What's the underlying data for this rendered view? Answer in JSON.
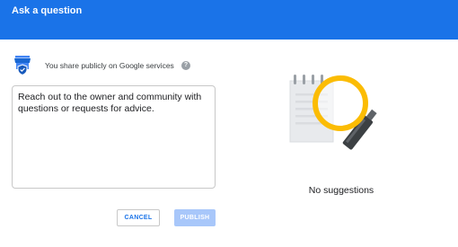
{
  "header": {
    "title": "Ask a question"
  },
  "share": {
    "text": "You share publicly on Google services",
    "help_glyph": "?"
  },
  "question": {
    "placeholder": "Reach out to the owner and community with questions or requests for advice."
  },
  "actions": {
    "cancel_label": "CANCEL",
    "publish_label": "PUBLISH"
  },
  "suggestions": {
    "empty_text": "No suggestions"
  },
  "icons": {
    "store": "store-shield-icon",
    "help": "help-icon",
    "illustration": "magnifier-notepad-illustration"
  },
  "colors": {
    "header": "#1a73e8",
    "accent": "#1a73e8",
    "publish_disabled": "#a8c7fa",
    "magnifier": "#fbbc04"
  }
}
